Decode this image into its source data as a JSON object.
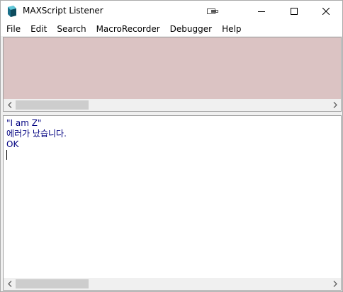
{
  "window": {
    "title": "MAXScript Listener",
    "icon": "3ds-max-icon",
    "buttons": {
      "extra": "dock-icon",
      "minimize": "minimize-icon",
      "maximize": "maximize-icon",
      "close": "close-icon"
    }
  },
  "menu": {
    "items": [
      {
        "label": "File"
      },
      {
        "label": "Edit"
      },
      {
        "label": "Search"
      },
      {
        "label": "MacroRecorder"
      },
      {
        "label": "Debugger"
      },
      {
        "label": "Help"
      }
    ]
  },
  "macro_recorder": {
    "background_color": "#dbc3c3",
    "lines": []
  },
  "listener": {
    "text_color": "#000080",
    "lines": [
      "\"I am Z\"",
      "에러가 났습니다.",
      "OK"
    ]
  },
  "colors": {
    "titlebar": "#ffffff",
    "chrome": "#f0f0f0",
    "scroll_thumb": "#cdcdcd"
  }
}
